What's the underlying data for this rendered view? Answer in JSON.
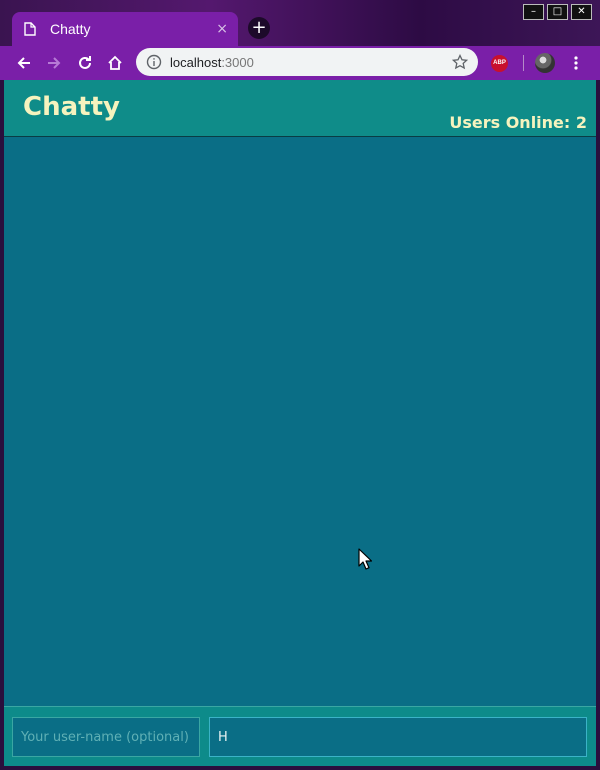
{
  "browser": {
    "tab_title": "Chatty",
    "tab_close": "×",
    "new_tab": "+",
    "url_host": "localhost",
    "url_port": ":3000",
    "adblock_label": "ABP",
    "window_controls": {
      "minimize": "–",
      "maximize": "□",
      "close": "✕"
    }
  },
  "app": {
    "title": "Chatty",
    "users_online": "Users Online: 2"
  },
  "composer": {
    "username_placeholder": "Your user-name (optional)",
    "username_value": "",
    "message_value": "H"
  },
  "colors": {
    "header_bg": "#0f8c89",
    "chat_bg": "#0a6e86",
    "title_text": "#f6f3be",
    "browser_accent": "#7a1fa8"
  }
}
